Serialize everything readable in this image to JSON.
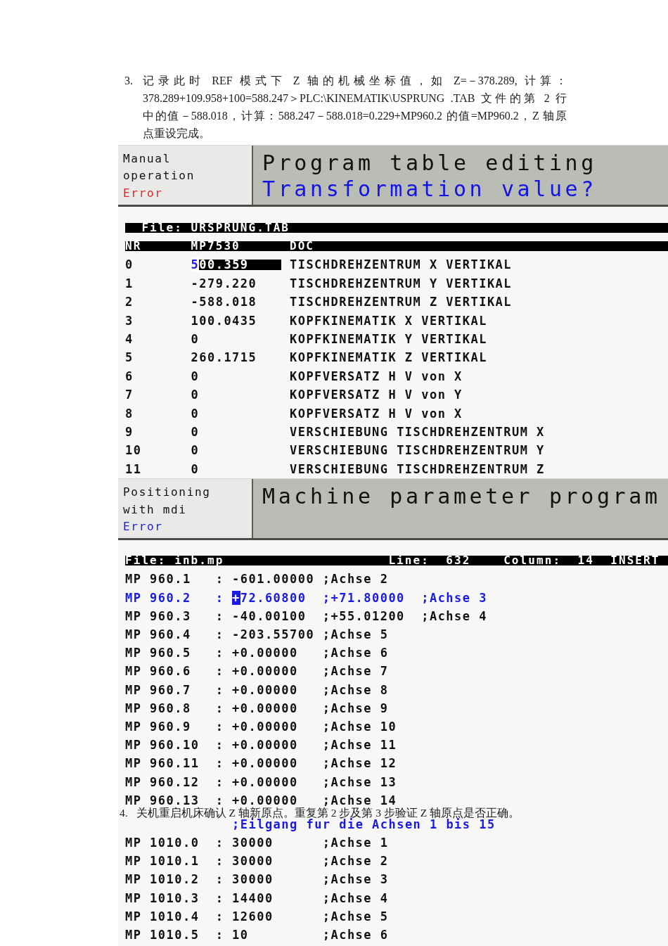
{
  "steps": [
    {
      "number": "3.",
      "lines": [
        "记录此时 REF 模式下 Z 轴的机械坐标值，如 Z=－378.289, 计算：",
        "378.289+109.958+100=588.247＞PLC:\\KINEMATIK\\USPRUNG .TAB 文件的第 2 行",
        "中的值－588.018，计算：588.247－588.018=0.229+MP960.2 的值=MP960.2，Z 轴原",
        "点重设完成。"
      ]
    },
    {
      "number": "4.",
      "lines": [
        "关机重启机床确认 Z 轴新原点。重复第 2 步及第 3 步验证 Z 轴原点是否正确。"
      ]
    }
  ],
  "screens": [
    {
      "kind": "table",
      "mode": {
        "label": "Manual operation",
        "status": {
          "text": "Error",
          "color": "#e8202a"
        }
      },
      "title": "Program table editing",
      "prompt": "Transformation value?",
      "file_bar": {
        "file": "File: URSPRUNG.TAB"
      },
      "table": {
        "columns": [
          "NR",
          "MP7530",
          "DOC"
        ],
        "rows": [
          {
            "cells": [
              "0",
              "500.359",
              "TISCHDREHZENTRUM X VERTIKAL"
            ],
            "selected": true
          },
          {
            "cells": [
              "1",
              "-279.220",
              "TISCHDREHZENTRUM Y VERTIKAL"
            ],
            "selected": false
          },
          {
            "cells": [
              "2",
              "-588.018",
              "TISCHDREHZENTRUM Z VERTIKAL"
            ],
            "selected": false
          },
          {
            "cells": [
              "3",
              "100.0435",
              "KOPFKINEMATIK X VERTIKAL"
            ],
            "selected": false
          },
          {
            "cells": [
              "4",
              "0",
              "KOPFKINEMATIK Y VERTIKAL"
            ],
            "selected": false
          },
          {
            "cells": [
              "5",
              "260.1715",
              "KOPFKINEMATIK Z VERTIKAL"
            ],
            "selected": false
          },
          {
            "cells": [
              "6",
              "0",
              "KOPFVERSATZ H V von X"
            ],
            "selected": false
          },
          {
            "cells": [
              "7",
              "0",
              "KOPFVERSATZ H V von Y"
            ],
            "selected": false
          },
          {
            "cells": [
              "8",
              "0",
              "KOPFVERSATZ H V von X"
            ],
            "selected": false
          },
          {
            "cells": [
              "9",
              "0",
              "VERSCHIEBUNG TISCHDREHZENTRUM X"
            ],
            "selected": false
          },
          {
            "cells": [
              "10",
              "0",
              "VERSCHIEBUNG TISCHDREHZENTRUM Y"
            ],
            "selected": false
          },
          {
            "cells": [
              "11",
              "0",
              "VERSCHIEBUNG TISCHDREHZENTRUM Z"
            ],
            "selected": false
          }
        ]
      }
    },
    {
      "kind": "editor",
      "mode": {
        "label": "Positioning with mdi",
        "status": {
          "text": "Error",
          "color": "#1a1ae6"
        }
      },
      "title": "Machine parameter program",
      "file_bar": {
        "file": "File: inb.mp",
        "fields": [
          {
            "label": "Line:",
            "value": "632"
          },
          {
            "label": "Column:",
            "value": "14"
          }
        ],
        "mode": "INSERT"
      },
      "lines": [
        {
          "kind": "parameter",
          "name": "MP 960.1",
          "separator": ":",
          "value": "-601.00000",
          "comments": [
            ";Achse 2"
          ],
          "selected": false
        },
        {
          "kind": "parameter",
          "name": "MP 960.2",
          "separator": ":",
          "value": "+72.60800",
          "comments": [
            ";+71.80000",
            ";Achse 3"
          ],
          "selected": true
        },
        {
          "kind": "parameter",
          "name": "MP 960.3",
          "separator": ":",
          "value": "-40.00100",
          "comments": [
            ";+55.01200",
            ";Achse 4"
          ],
          "selected": false
        },
        {
          "kind": "parameter",
          "name": "MP 960.4",
          "separator": ":",
          "value": "-203.55700",
          "comments": [
            ";Achse 5"
          ],
          "selected": false
        },
        {
          "kind": "parameter",
          "name": "MP 960.5",
          "separator": ":",
          "value": "+0.00000",
          "comments": [
            ";Achse 6"
          ],
          "selected": false
        },
        {
          "kind": "parameter",
          "name": "MP 960.6",
          "separator": ":",
          "value": "+0.00000",
          "comments": [
            ";Achse 7"
          ],
          "selected": false
        },
        {
          "kind": "parameter",
          "name": "MP 960.7",
          "separator": ":",
          "value": "+0.00000",
          "comments": [
            ";Achse 8"
          ],
          "selected": false
        },
        {
          "kind": "parameter",
          "name": "MP 960.8",
          "separator": ":",
          "value": "+0.00000",
          "comments": [
            ";Achse 9"
          ],
          "selected": false
        },
        {
          "kind": "parameter",
          "name": "MP 960.9",
          "separator": ":",
          "value": "+0.00000",
          "comments": [
            ";Achse 10"
          ],
          "selected": false
        },
        {
          "kind": "parameter",
          "name": "MP 960.10",
          "separator": ":",
          "value": "+0.00000",
          "comments": [
            ";Achse 11"
          ],
          "selected": false
        },
        {
          "kind": "parameter",
          "name": "MP 960.11",
          "separator": ":",
          "value": "+0.00000",
          "comments": [
            ";Achse 12"
          ],
          "selected": false
        },
        {
          "kind": "parameter",
          "name": "MP 960.12",
          "separator": ":",
          "value": "+0.00000",
          "comments": [
            ";Achse 13"
          ],
          "selected": false
        },
        {
          "kind": "parameter",
          "name": "MP 960.13",
          "separator": ":",
          "value": "+0.00000",
          "comments": [
            ";Achse 14"
          ],
          "selected": false
        },
        {
          "kind": "comment",
          "text": ";Eilgang fur die Achsen 1 bis 15",
          "selected": false
        },
        {
          "kind": "parameter",
          "name": "MP 1010.0",
          "separator": ":",
          "value": "30000",
          "comments": [
            ";Achse 1"
          ],
          "selected": false
        },
        {
          "kind": "parameter",
          "name": "MP 1010.1",
          "separator": ":",
          "value": "30000",
          "comments": [
            ";Achse 2"
          ],
          "selected": false
        },
        {
          "kind": "parameter",
          "name": "MP 1010.2",
          "separator": ":",
          "value": "30000",
          "comments": [
            ";Achse 3"
          ],
          "selected": false
        },
        {
          "kind": "parameter",
          "name": "MP 1010.3",
          "separator": ":",
          "value": "14400",
          "comments": [
            ";Achse 4"
          ],
          "selected": false
        },
        {
          "kind": "parameter",
          "name": "MP 1010.4",
          "separator": ":",
          "value": "12600",
          "comments": [
            ";Achse 5"
          ],
          "selected": false
        },
        {
          "kind": "parameter",
          "name": "MP 1010.5",
          "separator": ":",
          "value": "10",
          "comments": [
            ";Achse 6"
          ],
          "selected": false
        }
      ]
    }
  ]
}
